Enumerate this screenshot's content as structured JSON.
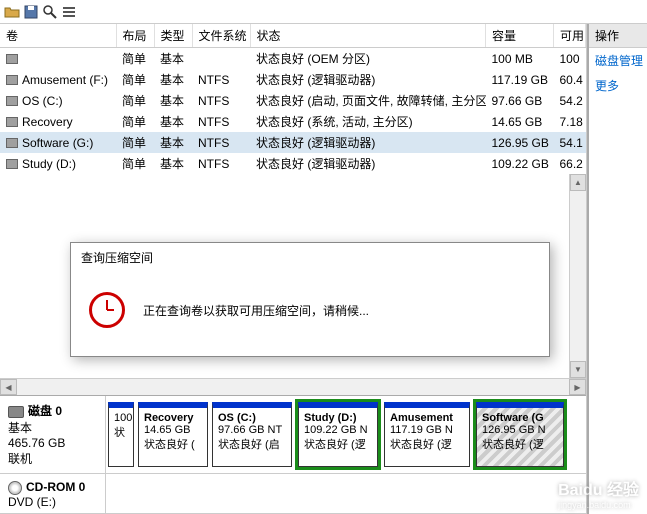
{
  "toolbar_icons": [
    "open",
    "save",
    "zoom",
    "list"
  ],
  "columns": {
    "vol": "卷",
    "layout": "布局",
    "type": "类型",
    "fs": "文件系统",
    "status": "状态",
    "capacity": "容量",
    "free": "可用"
  },
  "volumes": [
    {
      "name": "",
      "layout": "简单",
      "type": "基本",
      "fs": "",
      "status": "状态良好 (OEM 分区)",
      "capacity": "100 MB",
      "free": "100"
    },
    {
      "name": "Amusement  (F:)",
      "layout": "简单",
      "type": "基本",
      "fs": "NTFS",
      "status": "状态良好 (逻辑驱动器)",
      "capacity": "117.19 GB",
      "free": "60.4"
    },
    {
      "name": "OS (C:)",
      "layout": "简单",
      "type": "基本",
      "fs": "NTFS",
      "status": "状态良好 (启动, 页面文件, 故障转储, 主分区)",
      "capacity": "97.66 GB",
      "free": "54.2"
    },
    {
      "name": "Recovery",
      "layout": "简单",
      "type": "基本",
      "fs": "NTFS",
      "status": "状态良好 (系统, 活动, 主分区)",
      "capacity": "14.65 GB",
      "free": "7.18"
    },
    {
      "name": "Software (G:)",
      "layout": "简单",
      "type": "基本",
      "fs": "NTFS",
      "status": "状态良好 (逻辑驱动器)",
      "capacity": "126.95 GB",
      "free": "54.1",
      "selected": true
    },
    {
      "name": "Study (D:)",
      "layout": "简单",
      "type": "基本",
      "fs": "NTFS",
      "status": "状态良好 (逻辑驱动器)",
      "capacity": "109.22 GB",
      "free": "66.2"
    }
  ],
  "right": {
    "header": "操作",
    "link1": "磁盘管理",
    "link2": "更多"
  },
  "disk0": {
    "title": "磁盘 0",
    "type": "基本",
    "size": "465.76 GB",
    "state": "联机",
    "parts": [
      {
        "name": "",
        "line1": "100",
        "line2": "状"
      },
      {
        "name": "Recovery",
        "line1": "14.65 GB",
        "line2": "状态良好 ("
      },
      {
        "name": "OS  (C:)",
        "line1": "97.66 GB NT",
        "line2": "状态良好 (启"
      },
      {
        "name": "Study  (D:)",
        "line1": "109.22 GB N",
        "line2": "状态良好 (逻",
        "green": true
      },
      {
        "name": "Amusement",
        "line1": "117.19 GB N",
        "line2": "状态良好 (逻"
      },
      {
        "name": "Software  (G",
        "line1": "126.95 GB N",
        "line2": "状态良好 (逻",
        "green": true,
        "hatched": true
      }
    ]
  },
  "cdrom": {
    "title": "CD-ROM 0",
    "sub": "DVD (E:)"
  },
  "dialog": {
    "title": "查询压缩空间",
    "msg": "正在查询卷以获取可用压缩空间，请稍候..."
  },
  "watermark": {
    "brand": "Baidu 经验",
    "url": "jingyan.baidu.com"
  }
}
